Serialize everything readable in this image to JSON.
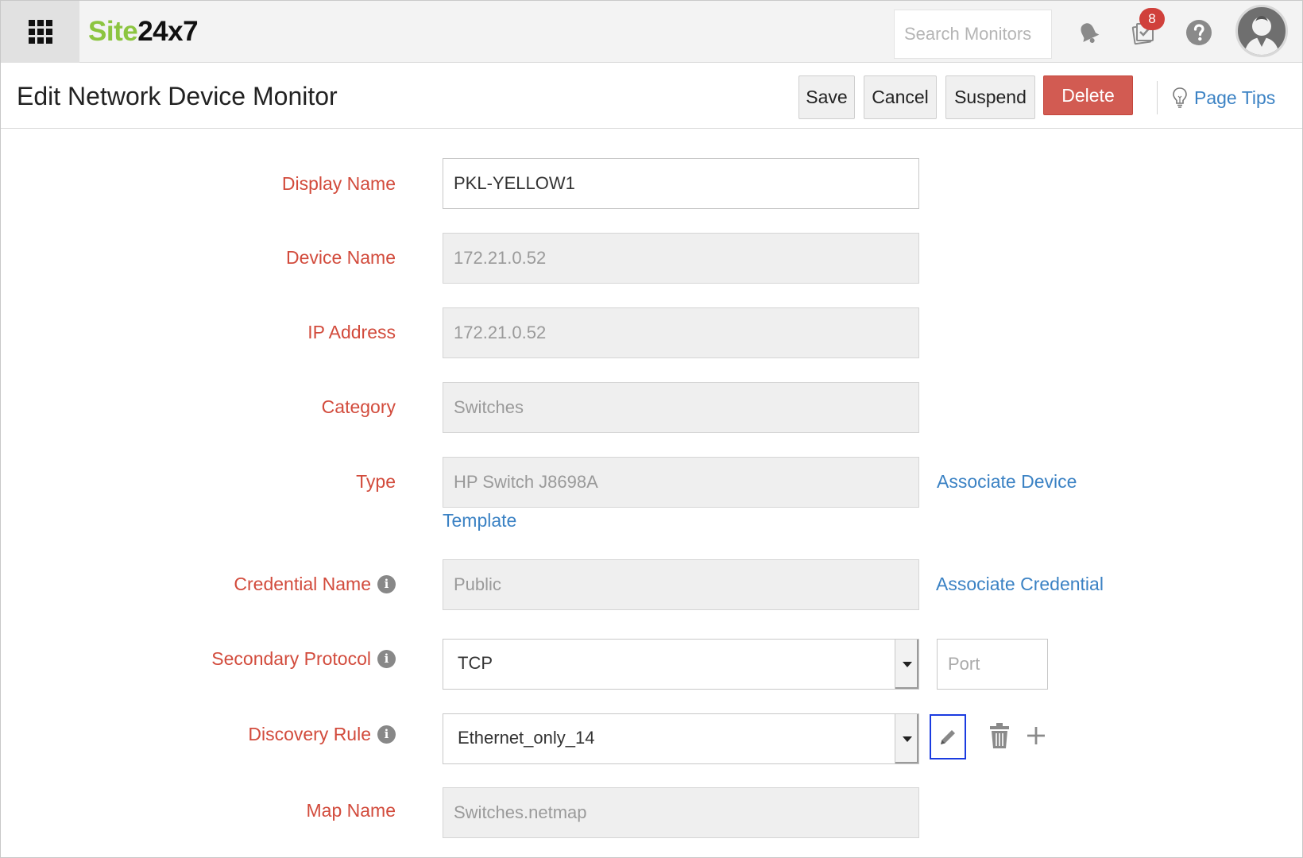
{
  "app": {
    "logo_part1": "Site",
    "logo_part2": "24x7"
  },
  "topbar": {
    "search_placeholder": "Search Monitors",
    "notification_count": "8"
  },
  "header": {
    "title": "Edit Network Device Monitor",
    "save_label": "Save",
    "cancel_label": "Cancel",
    "suspend_label": "Suspend",
    "delete_label": "Delete",
    "page_tips_label": "Page Tips"
  },
  "form": {
    "display_name": {
      "label": "Display Name",
      "value": "PKL-YELLOW1"
    },
    "device_name": {
      "label": "Device Name",
      "value": "172.21.0.52"
    },
    "ip_address": {
      "label": "IP Address",
      "value": "172.21.0.52"
    },
    "category": {
      "label": "Category",
      "value": "Switches"
    },
    "type": {
      "label": "Type",
      "value": "HP Switch J8698A",
      "link_part1": "Associate Device",
      "link_part2": "Template"
    },
    "credential_name": {
      "label": "Credential Name",
      "value": "Public",
      "link": "Associate Credential"
    },
    "secondary_protocol": {
      "label": "Secondary Protocol",
      "value": "TCP",
      "port_placeholder": "Port"
    },
    "discovery_rule": {
      "label": "Discovery Rule",
      "value": "Ethernet_only_14"
    },
    "map_name": {
      "label": "Map Name",
      "value": "Switches.netmap"
    }
  },
  "colors": {
    "label": "#d24b3c",
    "link": "#3b82c4",
    "delete": "#d25b52",
    "badge": "#d0403b",
    "logo_green": "#8cc540"
  },
  "icons": {
    "apps": "apps-grid-icon",
    "bell": "bell-icon",
    "tasks": "tasks-icon",
    "help": "help-icon",
    "avatar": "user-avatar-icon",
    "tips": "lightbulb-icon",
    "info": "info-icon",
    "edit": "pencil-icon",
    "delete": "trash-icon",
    "add": "plus-icon"
  }
}
